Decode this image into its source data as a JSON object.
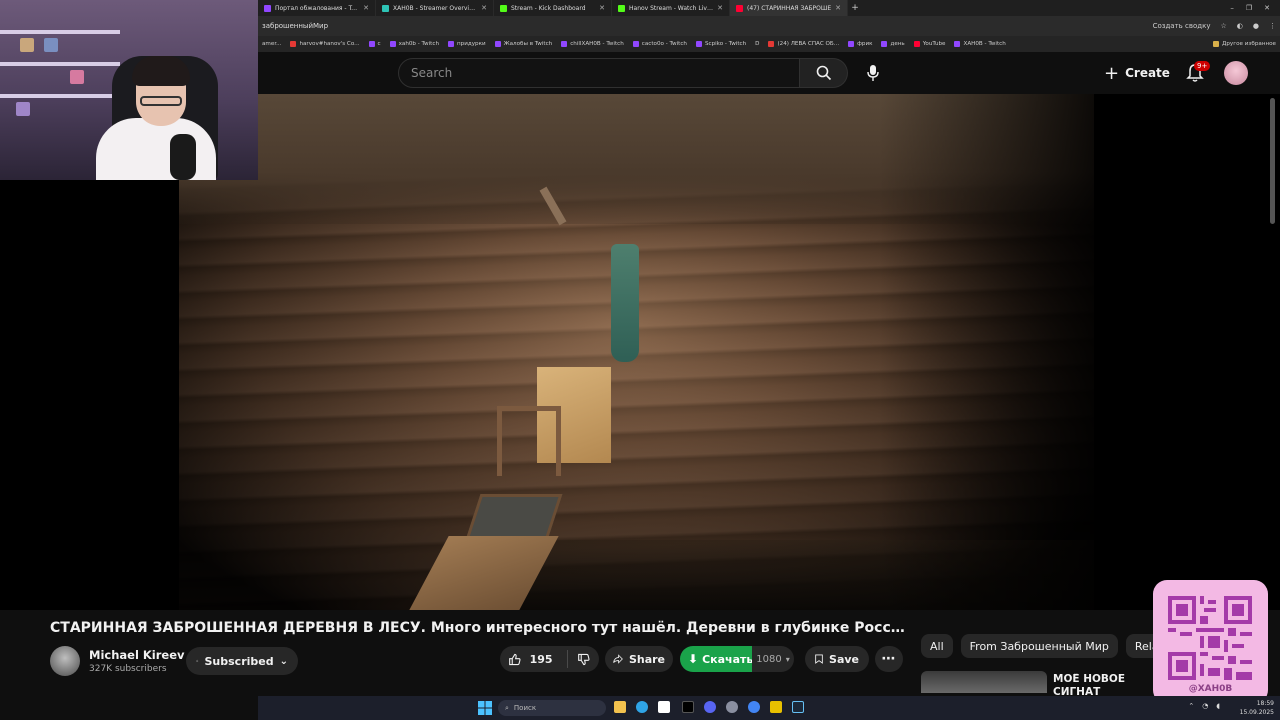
{
  "browser": {
    "tabs": [
      {
        "title": "Портал обжалования - Twitch",
        "color": "#9147ff"
      },
      {
        "title": "XAH0B - Streamer Overview & St",
        "color": "#2ec4b6"
      },
      {
        "title": "Stream - Kick Dashboard",
        "color": "#53fc18"
      },
      {
        "title": "Hanov Stream - Watch Live on K",
        "color": "#53fc18"
      },
      {
        "title": "(47) СТАРИННАЯ ЗАБРОШЕ",
        "color": "#ff0033"
      }
    ],
    "address_text": "заброшенныйМир",
    "create_digest": "Создать сводку",
    "bookmarks": [
      "amer...",
      "harvov#hanov's Co...",
      "c",
      "xah0b - Twitch",
      "придурки",
      "Жалобы в Twitch",
      "chillXAH0B - Twitch",
      "cacto0o - Twitch",
      "Scpiko - Twitch",
      "D",
      "(24) ЛЕВА СПАС ОБ...",
      "фрик",
      "день",
      "YouTube",
      "XAH0B - Twitch"
    ],
    "other_bookmarks": "Другое избранное"
  },
  "youtube": {
    "search_placeholder": "Search",
    "create_label": "Create",
    "notification_badge": "9+"
  },
  "video": {
    "title": "СТАРИННАЯ ЗАБРОШЕННАЯ ДЕРЕВНЯ В ЛЕСУ. Много интересного тут нашёл. Деревни в глубинке России.",
    "channel_name": "Michael Kireev",
    "subscribers": "327K subscribers",
    "subscribed_label": "Subscribed",
    "likes": "195",
    "share_label": "Share",
    "download_label": "Скачать",
    "quality": "1080",
    "save_label": "Save"
  },
  "related": {
    "chips": [
      "All",
      "From Заброшенный Мир",
      "Related"
    ],
    "first_title": "МОЁ НОВОЕ СИГНАТ ОРУЖИЕ В PUBG"
  },
  "overlay": {
    "qr_handle": "@XAH0B"
  },
  "taskbar": {
    "search_label": "Поиск",
    "time": "18:59",
    "date": "15.09.2025"
  },
  "colors": {
    "accent_red": "#cc0000",
    "download_green": "#1aa34a",
    "qr_pink": "#f3b9e4"
  }
}
